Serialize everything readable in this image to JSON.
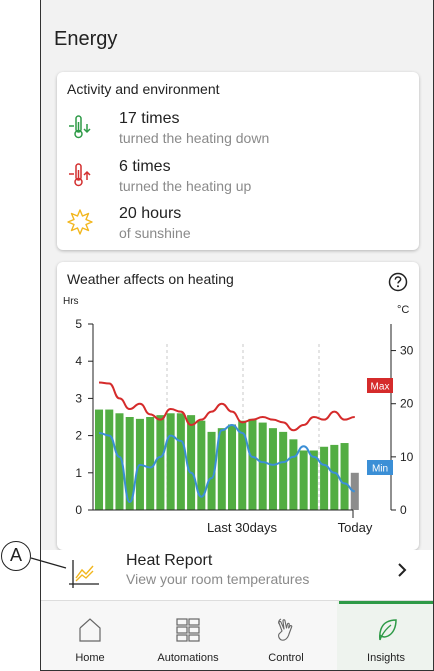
{
  "page": {
    "title": "Energy"
  },
  "activity": {
    "title": "Activity and environment",
    "items": [
      {
        "value": "17 times",
        "label": "turned the heating down",
        "icon": "thermometer-down-icon",
        "color": "#2e9a47"
      },
      {
        "value": "6 times",
        "label": "turned the heating up",
        "icon": "thermometer-up-icon",
        "color": "#d32f2f"
      },
      {
        "value": "20 hours",
        "label": "of sunshine",
        "icon": "sun-icon",
        "color": "#f2b61c"
      }
    ]
  },
  "weather": {
    "title": "Weather affects on heating",
    "help_icon": "help-icon",
    "max_label": "Max",
    "min_label": "Min",
    "x_label": "Last 30days",
    "today_label": "Today"
  },
  "chart_data": {
    "type": "bar",
    "ylabel": "Hrs",
    "y2label": "°C",
    "ylim": [
      0,
      5
    ],
    "y2lim": [
      0,
      35
    ],
    "y_ticks": [
      "0",
      "1",
      "2",
      "3",
      "4",
      "5"
    ],
    "y2_ticks": [
      "0",
      "10",
      "20",
      "30"
    ],
    "x_ticks": [
      "Last 30days",
      "Today"
    ],
    "grid": "vertical dashed",
    "colors": {
      "bars": "#52ad42",
      "today_bar": "#8c8c8c",
      "max_line": "#d52b2b",
      "min_line": "#3b8fd6"
    },
    "series": [
      {
        "name": "Heating hours",
        "kind": "bar",
        "values": [
          2.7,
          2.7,
          2.6,
          2.5,
          2.45,
          2.5,
          2.55,
          2.6,
          2.6,
          2.55,
          2.4,
          2.1,
          2.2,
          2.3,
          2.4,
          2.45,
          2.35,
          2.2,
          2.1,
          1.9,
          1.6,
          1.6,
          1.7,
          1.75,
          1.8,
          1.0
        ]
      },
      {
        "name": "Max",
        "kind": "line",
        "axis": "right",
        "values": [
          24,
          23.8,
          21,
          19,
          20,
          18,
          17,
          19,
          18.5,
          16,
          17,
          18.5,
          20,
          18.5,
          16.5,
          17,
          17.5,
          17,
          16.5,
          15,
          16,
          17.5,
          17,
          18.5,
          17,
          17.5
        ]
      },
      {
        "name": "Min",
        "kind": "line",
        "axis": "right",
        "values": [
          14.5,
          14,
          10,
          1.5,
          8.5,
          8,
          10,
          14,
          13,
          7,
          2.5,
          6,
          15,
          16,
          14.5,
          10,
          9,
          8.5,
          9,
          10,
          12,
          10,
          8.5,
          7,
          5,
          3.5
        ]
      }
    ]
  },
  "report": {
    "title": "Heat Report",
    "subtitle": "View your room temperatures",
    "icon": "chart-line-icon"
  },
  "callout": {
    "label": "A"
  },
  "tabs": [
    {
      "label": "Home",
      "icon": "home-icon",
      "active": false
    },
    {
      "label": "Automations",
      "icon": "grid-icon",
      "active": false
    },
    {
      "label": "Control",
      "icon": "hand-touch-icon",
      "active": false
    },
    {
      "label": "Insights",
      "icon": "leaf-icon",
      "active": true
    }
  ]
}
